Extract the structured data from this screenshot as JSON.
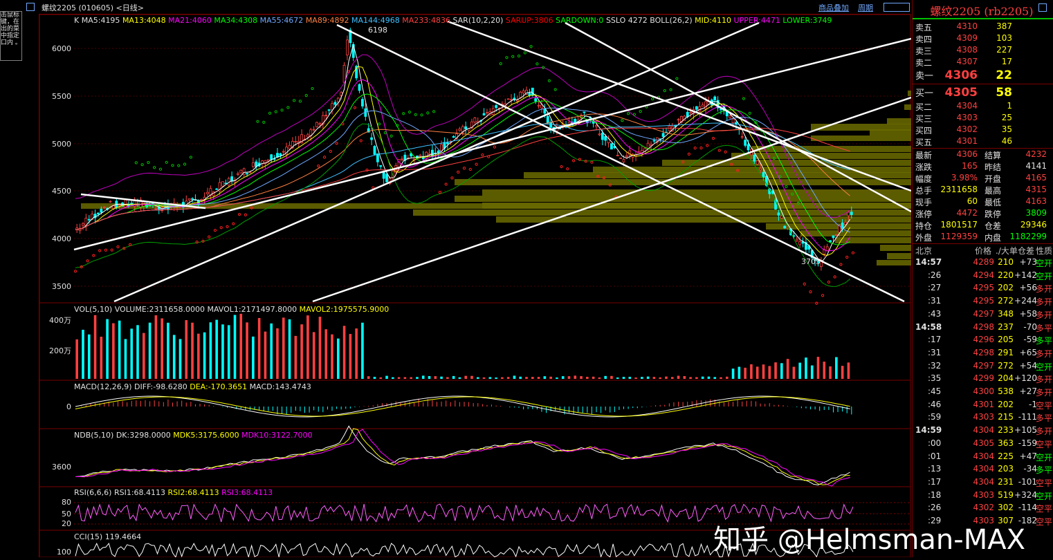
{
  "window": {
    "title": "螺纹2205 (010605) <日线>",
    "links": [
      "商品叠加",
      "周期"
    ]
  },
  "tooltip_text": "击鼠标 键，在 出的菜 中指定 口内 。",
  "main_chart": {
    "indicator_line": [
      {
        "text": "K",
        "color": "#e0e0e0"
      },
      {
        "text": "MA5:4195",
        "color": "#e0e0e0"
      },
      {
        "text": "MA13:4048",
        "color": "#ffff00"
      },
      {
        "text": "MA21:4060",
        "color": "#ff00ff"
      },
      {
        "text": "MA34:4308",
        "color": "#00ff00"
      },
      {
        "text": "MA55:4672",
        "color": "#6fa8ff"
      },
      {
        "text": "MA89:4892",
        "color": "#ff8040"
      },
      {
        "text": "MA144:4968",
        "color": "#40c0ff"
      },
      {
        "text": "MA233:4836",
        "color": "#ff4040"
      },
      {
        "text": "SAR(10,2,20)",
        "color": "#e0e0e0"
      },
      {
        "text": "SARUP:3806",
        "color": "#ff0000"
      },
      {
        "text": "SARDOWN:0",
        "color": "#00ff00"
      },
      {
        "text": "SSLO 4272",
        "color": "#e0e0e0"
      },
      {
        "text": "BOLL(26,2)",
        "color": "#e0e0e0"
      },
      {
        "text": "MID:4110",
        "color": "#ffff00"
      },
      {
        "text": "UPPER:4471",
        "color": "#ff00ff"
      },
      {
        "text": "LOWER:3749",
        "color": "#00ff00"
      }
    ],
    "y_ticks": [
      "6000",
      "5500",
      "5000",
      "4500",
      "4000",
      "3500"
    ],
    "high_label": "6198",
    "low_label": "3705"
  },
  "vol_panel": {
    "indicator_line": [
      {
        "text": "VOL(5,10)",
        "color": "#e0e0e0"
      },
      {
        "text": "VOLUME:2311658.0000",
        "color": "#e0e0e0"
      },
      {
        "text": "MAVOL1:2171497.8000",
        "color": "#e0e0e0"
      },
      {
        "text": "MAVOL2:1975575.9000",
        "color": "#ffff00"
      }
    ],
    "y_ticks": [
      "400万",
      "200万"
    ]
  },
  "macd_panel": {
    "indicator_line": [
      {
        "text": "MACD(12,26,9)",
        "color": "#e0e0e0"
      },
      {
        "text": "DIFF:-98.6280",
        "color": "#e0e0e0"
      },
      {
        "text": "DEA:-170.3651",
        "color": "#ffff00"
      },
      {
        "text": "MACD:143.4743",
        "color": "#e0e0e0"
      }
    ],
    "y_ticks": [
      "0"
    ]
  },
  "ndb_panel": {
    "indicator_line": [
      {
        "text": "NDB(5,10)",
        "color": "#e0e0e0"
      },
      {
        "text": "DK:3298.0000",
        "color": "#e0e0e0"
      },
      {
        "text": "MDK5:3175.6000",
        "color": "#ffff00"
      },
      {
        "text": "MDK10:3122.7000",
        "color": "#ff00ff"
      }
    ],
    "y_ticks": [
      "3600"
    ]
  },
  "rsi_panel": {
    "indicator_line": [
      {
        "text": "RSI(6,6,6)",
        "color": "#e0e0e0"
      },
      {
        "text": "RSI1:68.4113",
        "color": "#e0e0e0"
      },
      {
        "text": "RSI2:68.4113",
        "color": "#ffff00"
      },
      {
        "text": "RSI3:68.4113",
        "color": "#ff00ff"
      }
    ],
    "y_ticks": [
      "80",
      "50",
      "20"
    ]
  },
  "cci_panel": {
    "indicator_line": [
      {
        "text": "CCI(15)",
        "color": "#e0e0e0"
      },
      {
        "text": "119.4664",
        "color": "#e0e0e0"
      }
    ],
    "y_ticks": [
      "100"
    ]
  },
  "quote": {
    "title": "螺纹2205 (rb2205)",
    "asks": [
      {
        "label": "卖五",
        "price": "4310",
        "vol": "387"
      },
      {
        "label": "卖四",
        "price": "4309",
        "vol": "103"
      },
      {
        "label": "卖三",
        "price": "4308",
        "vol": "227"
      },
      {
        "label": "卖二",
        "price": "4307",
        "vol": "17"
      },
      {
        "label": "卖一",
        "price": "4306",
        "vol": "22"
      }
    ],
    "bids": [
      {
        "label": "买一",
        "price": "4305",
        "vol": "58"
      },
      {
        "label": "买二",
        "price": "4304",
        "vol": "1"
      },
      {
        "label": "买三",
        "price": "4303",
        "vol": "25"
      },
      {
        "label": "买四",
        "price": "4302",
        "vol": "35"
      },
      {
        "label": "买五",
        "price": "4301",
        "vol": "46"
      }
    ],
    "stats": [
      {
        "l1": "最新",
        "v1": "4306",
        "c1": "#ff4040",
        "l2": "结算",
        "v2": "4232",
        "c2": "#ff4040"
      },
      {
        "l1": "涨跌",
        "v1": "165",
        "c1": "#ff4040",
        "l2": "昨结",
        "v2": "4141",
        "c2": "#e0e0e0"
      },
      {
        "l1": "幅度",
        "v1": "3.98%",
        "c1": "#ff4040",
        "l2": "开盘",
        "v2": "4165",
        "c2": "#ff4040"
      },
      {
        "l1": "总手",
        "v1": "2311658",
        "c1": "#ffff00",
        "l2": "最高",
        "v2": "4315",
        "c2": "#ff4040"
      },
      {
        "l1": "现手",
        "v1": "60",
        "c1": "#ffff00",
        "l2": "最低",
        "v2": "4163",
        "c2": "#ff4040"
      },
      {
        "l1": "涨停",
        "v1": "4472",
        "c1": "#ff4040",
        "l2": "跌停",
        "v2": "3809",
        "c2": "#00ff00"
      },
      {
        "l1": "持仓",
        "v1": "1801517",
        "c1": "#ffff00",
        "l2": "仓差",
        "v2": "29346",
        "c2": "#ffff00"
      },
      {
        "l1": "外盘",
        "v1": "1129359",
        "c1": "#ff4040",
        "l2": "内盘",
        "v2": "1182299",
        "c2": "#00ff00"
      }
    ],
    "tick_header": {
      "loc": "北京",
      "price": "价格",
      "vol": "./大单",
      "oi": "仓差",
      "nature": "性质"
    },
    "ticks": [
      {
        "t": "14:57",
        "p": "4289",
        "v": "210",
        "oi": "+73",
        "n": "空开",
        "nc": "#00ff00",
        "bold": true
      },
      {
        "t": ":26",
        "p": "4294",
        "v": "220",
        "oi": "+142",
        "n": "空开",
        "nc": "#00ff00",
        "bold": false
      },
      {
        "t": ":27",
        "p": "4295",
        "v": "202",
        "oi": "+56",
        "n": "多开",
        "nc": "#ff4040",
        "bold": false
      },
      {
        "t": ":31",
        "p": "4295",
        "v": "272",
        "oi": "+244",
        "n": "多开",
        "nc": "#ff4040",
        "bold": false
      },
      {
        "t": ":43",
        "p": "4297",
        "v": "348",
        "oi": "+58",
        "n": "多开",
        "nc": "#ff4040",
        "bold": false
      },
      {
        "t": "14:58",
        "p": "4298",
        "v": "237",
        "oi": "-70",
        "n": "多平",
        "nc": "#ff4040",
        "bold": true
      },
      {
        "t": ":17",
        "p": "4296",
        "v": "205",
        "oi": "-59",
        "n": "多平",
        "nc": "#00ff00",
        "bold": false
      },
      {
        "t": ":31",
        "p": "4298",
        "v": "291",
        "oi": "+65",
        "n": "多开",
        "nc": "#ff4040",
        "bold": false
      },
      {
        "t": ":32",
        "p": "4297",
        "v": "272",
        "oi": "+54",
        "n": "空开",
        "nc": "#00ff00",
        "bold": false
      },
      {
        "t": ":35",
        "p": "4299",
        "v": "204",
        "oi": "+120",
        "n": "多开",
        "nc": "#ff4040",
        "bold": false
      },
      {
        "t": ":45",
        "p": "4300",
        "v": "538",
        "oi": "+27",
        "n": "多开",
        "nc": "#ff4040",
        "bold": false
      },
      {
        "t": ":46",
        "p": "4301",
        "v": "202",
        "oi": "-1",
        "n": "空平",
        "nc": "#ff4040",
        "bold": false
      },
      {
        "t": ":59",
        "p": "4303",
        "v": "215",
        "oi": "-111",
        "n": "多平",
        "nc": "#ff4040",
        "bold": false
      },
      {
        "t": "14:59",
        "p": "4304",
        "v": "233",
        "oi": "+105",
        "n": "多开",
        "nc": "#ff4040",
        "bold": true
      },
      {
        "t": ":00",
        "p": "4305",
        "v": "363",
        "oi": "-159",
        "n": "空平",
        "nc": "#ff4040",
        "bold": false
      },
      {
        "t": ":01",
        "p": "4304",
        "v": "225",
        "oi": "+47",
        "n": "空开",
        "nc": "#00ff00",
        "bold": false
      },
      {
        "t": ":13",
        "p": "4304",
        "v": "203",
        "oi": "-34",
        "n": "多平",
        "nc": "#00ff00",
        "bold": false
      },
      {
        "t": ":17",
        "p": "4304",
        "v": "231",
        "oi": "-101",
        "n": "空平",
        "nc": "#ff4040",
        "bold": false
      },
      {
        "t": ":18",
        "p": "4303",
        "v": "519",
        "oi": "+324",
        "n": "空开",
        "nc": "#00ff00",
        "bold": false
      },
      {
        "t": ":26",
        "p": "4302",
        "v": "302",
        "oi": "-114",
        "n": "空平",
        "nc": "#ff4040",
        "bold": false
      },
      {
        "t": ":29",
        "p": "4303",
        "v": "307",
        "oi": "-182",
        "n": "空平",
        "nc": "#ff4040",
        "bold": false
      }
    ]
  },
  "watermark": "知乎 @Helmsman-MAX"
}
